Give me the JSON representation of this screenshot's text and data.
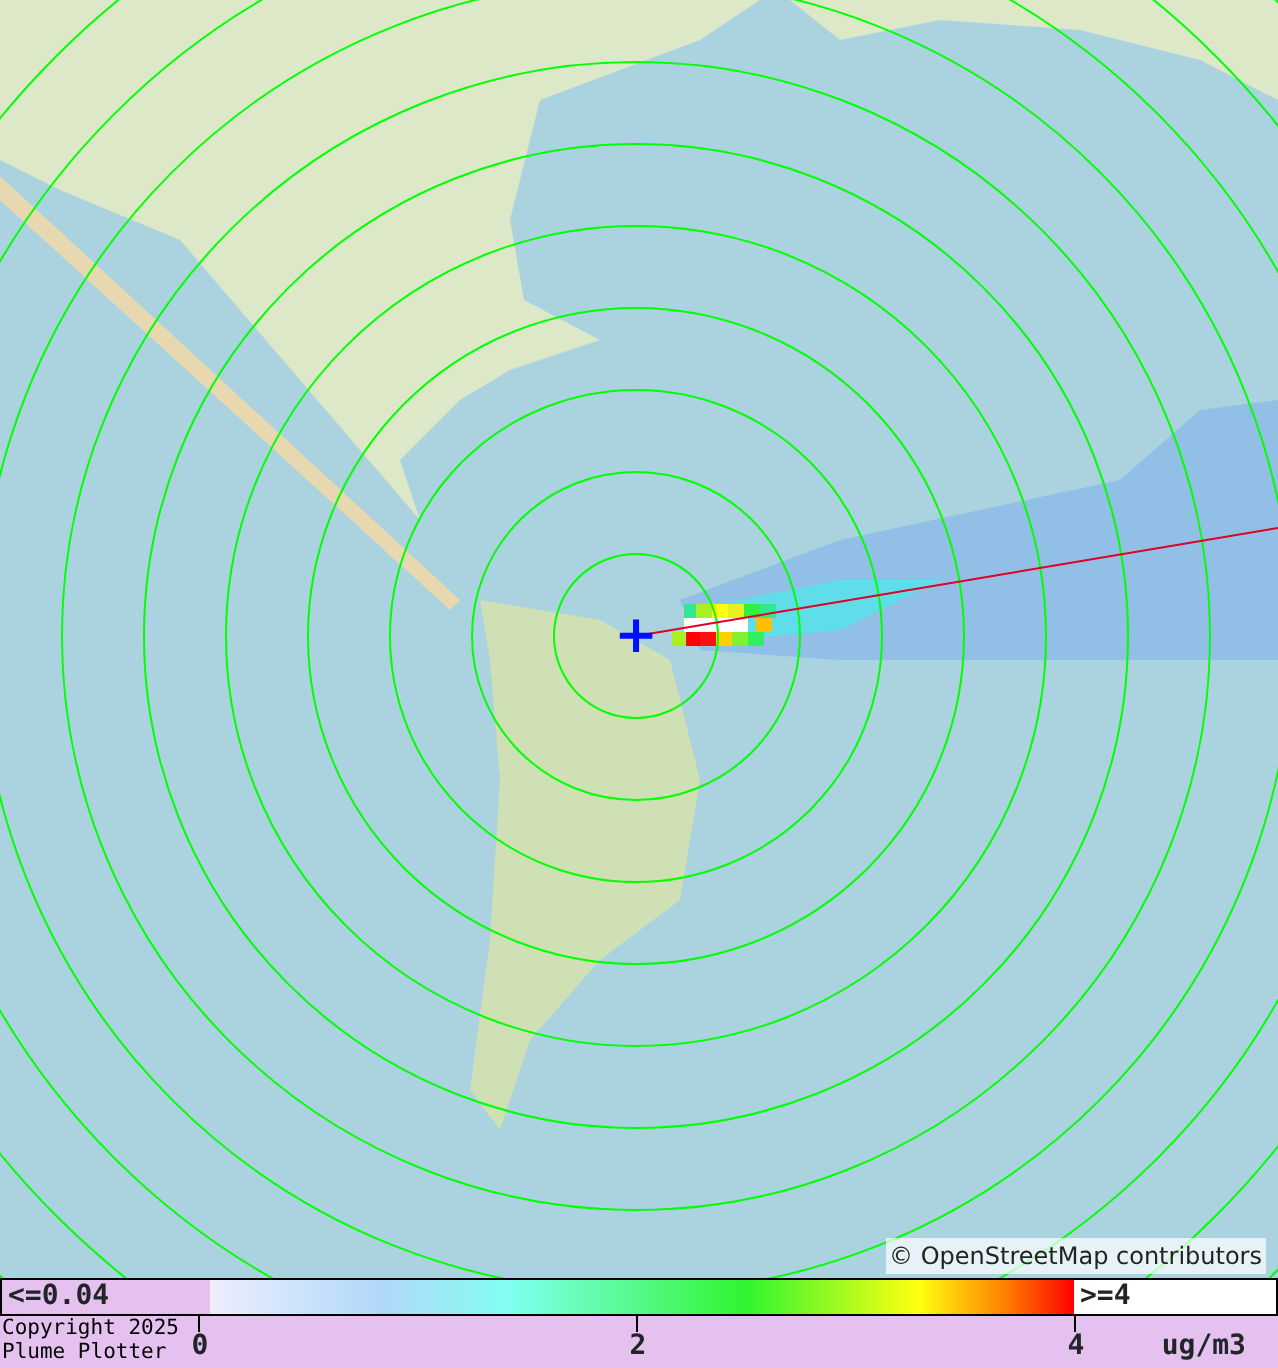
{
  "map": {
    "attribution": "© OpenStreetMap contributors",
    "source_marker": "+"
  },
  "legend": {
    "low_label": "<=0.04",
    "high_label": ">=4",
    "ticks": [
      "0",
      "2",
      "4"
    ],
    "unit": "ug/m3"
  },
  "copyright": [
    "Copyright 2025",
    "Plume Plotter"
  ]
}
